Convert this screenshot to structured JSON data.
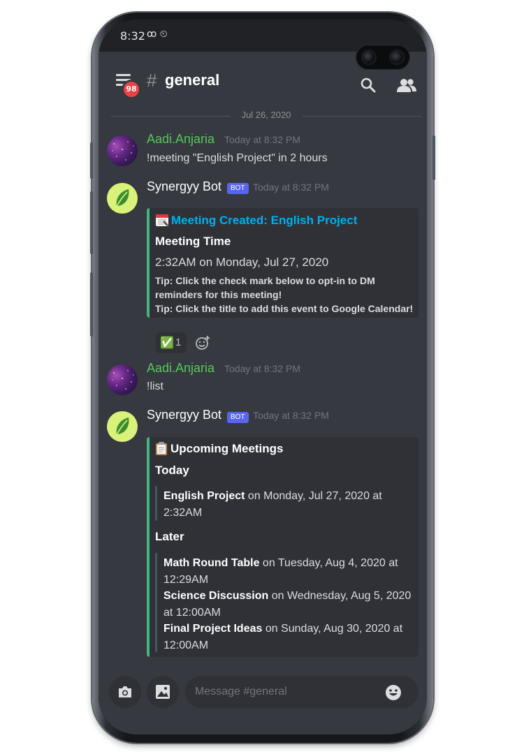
{
  "status_bar": {
    "time": "8:32",
    "icons": "ꝏ ⏲"
  },
  "header": {
    "channel_hash": "#",
    "channel_name": "general",
    "mention_count": "98"
  },
  "day_divider": "Jul 26, 2020",
  "messages": [
    {
      "author": "Aadi.Anjaria",
      "timestamp": "Today at 8:32 PM",
      "content": "!meeting \"English Project\" in 2 hours"
    },
    {
      "author": "Synergyy Bot",
      "tag": "BOT",
      "timestamp": "Today at 8:32 PM",
      "embed": {
        "title": "Meeting Created: English Project",
        "field_name": "Meeting Time",
        "field_value": "2:32AM on Monday, Jul 27, 2020",
        "tip_line1": "Tip: Click the check mark below to opt-in to DM",
        "tip_line2": "reminders for this meeting!",
        "tip_line3": "Tip: Click the title to add this event to Google Calendar!"
      },
      "reaction": {
        "emoji": "✅",
        "count": "1"
      }
    },
    {
      "author": "Aadi.Anjaria",
      "timestamp": "Today at 8:32 PM",
      "content": "!list"
    },
    {
      "author": "Synergyy Bot",
      "tag": "BOT",
      "timestamp": "Today at 8:32 PM",
      "embed": {
        "title": "Upcoming Meetings",
        "today_label": "Today",
        "today_items": [
          {
            "name": "English Project",
            "rest1": " on Monday, Jul 27, 2020 at",
            "rest2": "2:32AM"
          }
        ],
        "later_label": "Later",
        "later_items": [
          {
            "name": "Math Round Table",
            "rest1": " on Tuesday, Aug 4, 2020 at",
            "rest2": "12:29AM"
          },
          {
            "name": "Science Discussion",
            "rest1": " on Wednesday, Aug 5, 2020",
            "rest2": "at 12:00AM"
          },
          {
            "name": "Final Project Ideas",
            "rest1": " on Sunday, Aug 30, 2020 at",
            "rest2": "12:00AM"
          }
        ]
      }
    }
  ],
  "composer": {
    "placeholder": "Message #general"
  },
  "colors": {
    "background": "#36393f",
    "username_green": "#57c75e",
    "link_blue": "#00aff4",
    "embed_bar": "#43b581",
    "bot_tag": "#5865f2"
  }
}
